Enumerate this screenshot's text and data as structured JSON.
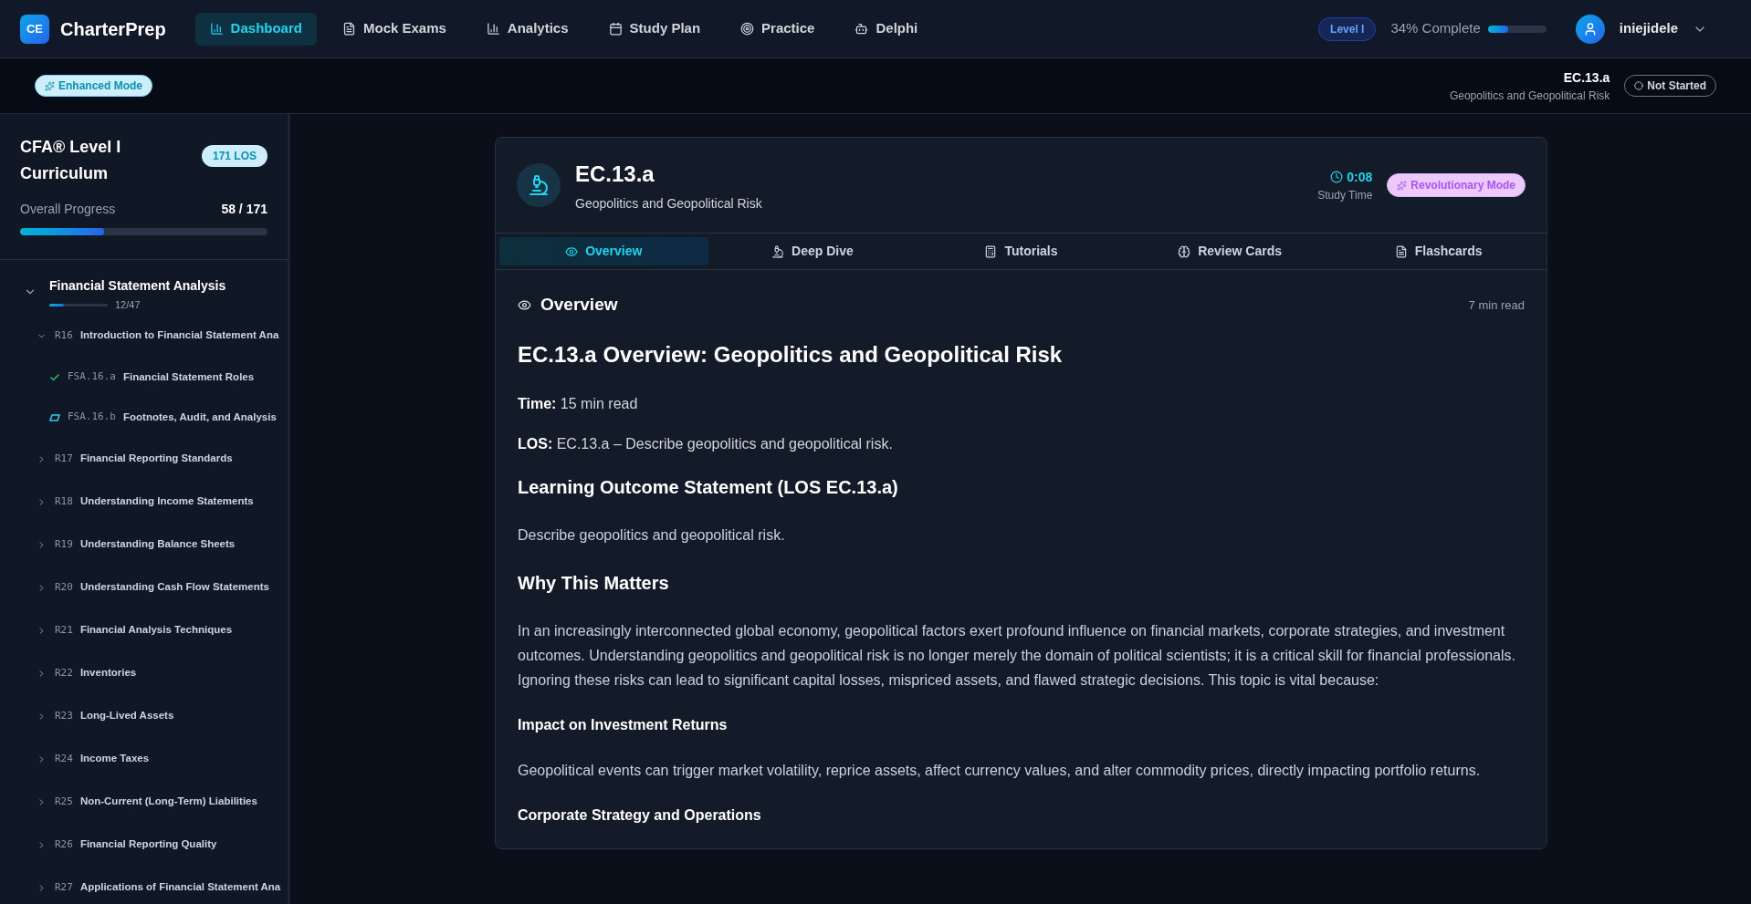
{
  "brand": {
    "logo": "CE",
    "name": "CharterPrep"
  },
  "nav": [
    {
      "label": "Dashboard",
      "selected": true
    },
    {
      "label": "Mock Exams",
      "selected": false
    },
    {
      "label": "Analytics",
      "selected": false
    },
    {
      "label": "Study Plan",
      "selected": false
    },
    {
      "label": "Practice",
      "selected": false
    },
    {
      "label": "Delphi",
      "selected": false
    }
  ],
  "level_badge": "Level I",
  "progress": {
    "label": "34% Complete",
    "level": 0.34
  },
  "user": {
    "name": "iniejidele"
  },
  "subbar": {
    "mode": "Enhanced Mode",
    "code": "EC.13.a",
    "title": "Geopolitics and Geopolitical Risk",
    "status": "Not Started"
  },
  "sidebar": {
    "title": "CFA® Level I Curriculum",
    "badge": "171 LOS",
    "progress_label": "Overall Progress",
    "progress_count": "58 / 171",
    "level": 0.34,
    "subject": {
      "name": "Financial Statement Analysis",
      "count": "12/47",
      "level": 0.255,
      "expanded": true,
      "readings": [
        {
          "code": "R16",
          "name": "Introduction to Financial Statement Ana",
          "expanded": true,
          "children": [
            {
              "code": "FSA.16.a",
              "name": "Financial Statement Roles",
              "kind": "done"
            },
            {
              "code": "FSA.16.b",
              "name": "Footnotes, Audit, and Analysis",
              "kind": "started"
            }
          ]
        },
        {
          "code": "R17",
          "name": "Financial Reporting Standards",
          "expanded": false
        },
        {
          "code": "R18",
          "name": "Understanding Income Statements",
          "expanded": false
        },
        {
          "code": "R19",
          "name": "Understanding Balance Sheets",
          "expanded": false
        },
        {
          "code": "R20",
          "name": "Understanding Cash Flow Statements",
          "expanded": false
        },
        {
          "code": "R21",
          "name": "Financial Analysis Techniques",
          "expanded": false
        },
        {
          "code": "R22",
          "name": "Inventories",
          "expanded": false
        },
        {
          "code": "R23",
          "name": "Long-Lived Assets",
          "expanded": false
        },
        {
          "code": "R24",
          "name": "Income Taxes",
          "expanded": false
        },
        {
          "code": "R25",
          "name": "Non-Current (Long-Term) Liabilities",
          "expanded": false
        },
        {
          "code": "R26",
          "name": "Financial Reporting Quality",
          "expanded": false
        },
        {
          "code": "R27",
          "name": "Applications of Financial Statement Ana",
          "expanded": false
        }
      ]
    }
  },
  "card": {
    "code": "EC.13.a",
    "title": "Geopolitics and Geopolitical Risk",
    "timer": "0:08",
    "timer_label": "Study Time",
    "mode": "Revolutionary Mode",
    "tabs": [
      {
        "label": "Overview",
        "selected": true
      },
      {
        "label": "Deep Dive",
        "selected": false
      },
      {
        "label": "Tutorials",
        "selected": false
      },
      {
        "label": "Review Cards",
        "selected": false
      },
      {
        "label": "Flashcards",
        "selected": false
      }
    ],
    "section_title": "Overview",
    "read_time": "7 min read",
    "blocks": [
      {
        "kind": "h1",
        "text": "EC.13.a Overview: Geopolitics and Geopolitical Risk"
      },
      {
        "kind": "meta",
        "text": "**Time:** 15 min read"
      },
      {
        "kind": "meta",
        "text": "**LOS:** EC.13.a – Describe geopolitics and geopolitical risk."
      },
      {
        "kind": "h2",
        "text": "Learning Outcome Statement (LOS EC.13.a)"
      },
      {
        "kind": "p",
        "text": "Describe geopolitics and geopolitical risk."
      },
      {
        "kind": "h2",
        "text": "Why This Matters"
      },
      {
        "kind": "p",
        "text": "In an increasingly interconnected global economy, geopolitical factors exert profound influence on financial markets, corporate strategies, and investment outcomes. Understanding geopolitics and geopolitical risk is no longer merely the domain of political scientists; it is a critical skill for financial professionals. Ignoring these risks can lead to significant capital losses, mispriced assets, and flawed strategic decisions. This topic is vital because:"
      },
      {
        "kind": "h3",
        "text": "Impact on Investment Returns"
      },
      {
        "kind": "p",
        "text": "Geopolitical events can trigger market volatility, reprice assets, affect currency values, and alter commodity prices, directly impacting portfolio returns."
      },
      {
        "kind": "h3",
        "text": "Corporate Strategy and Operations"
      }
    ]
  }
}
